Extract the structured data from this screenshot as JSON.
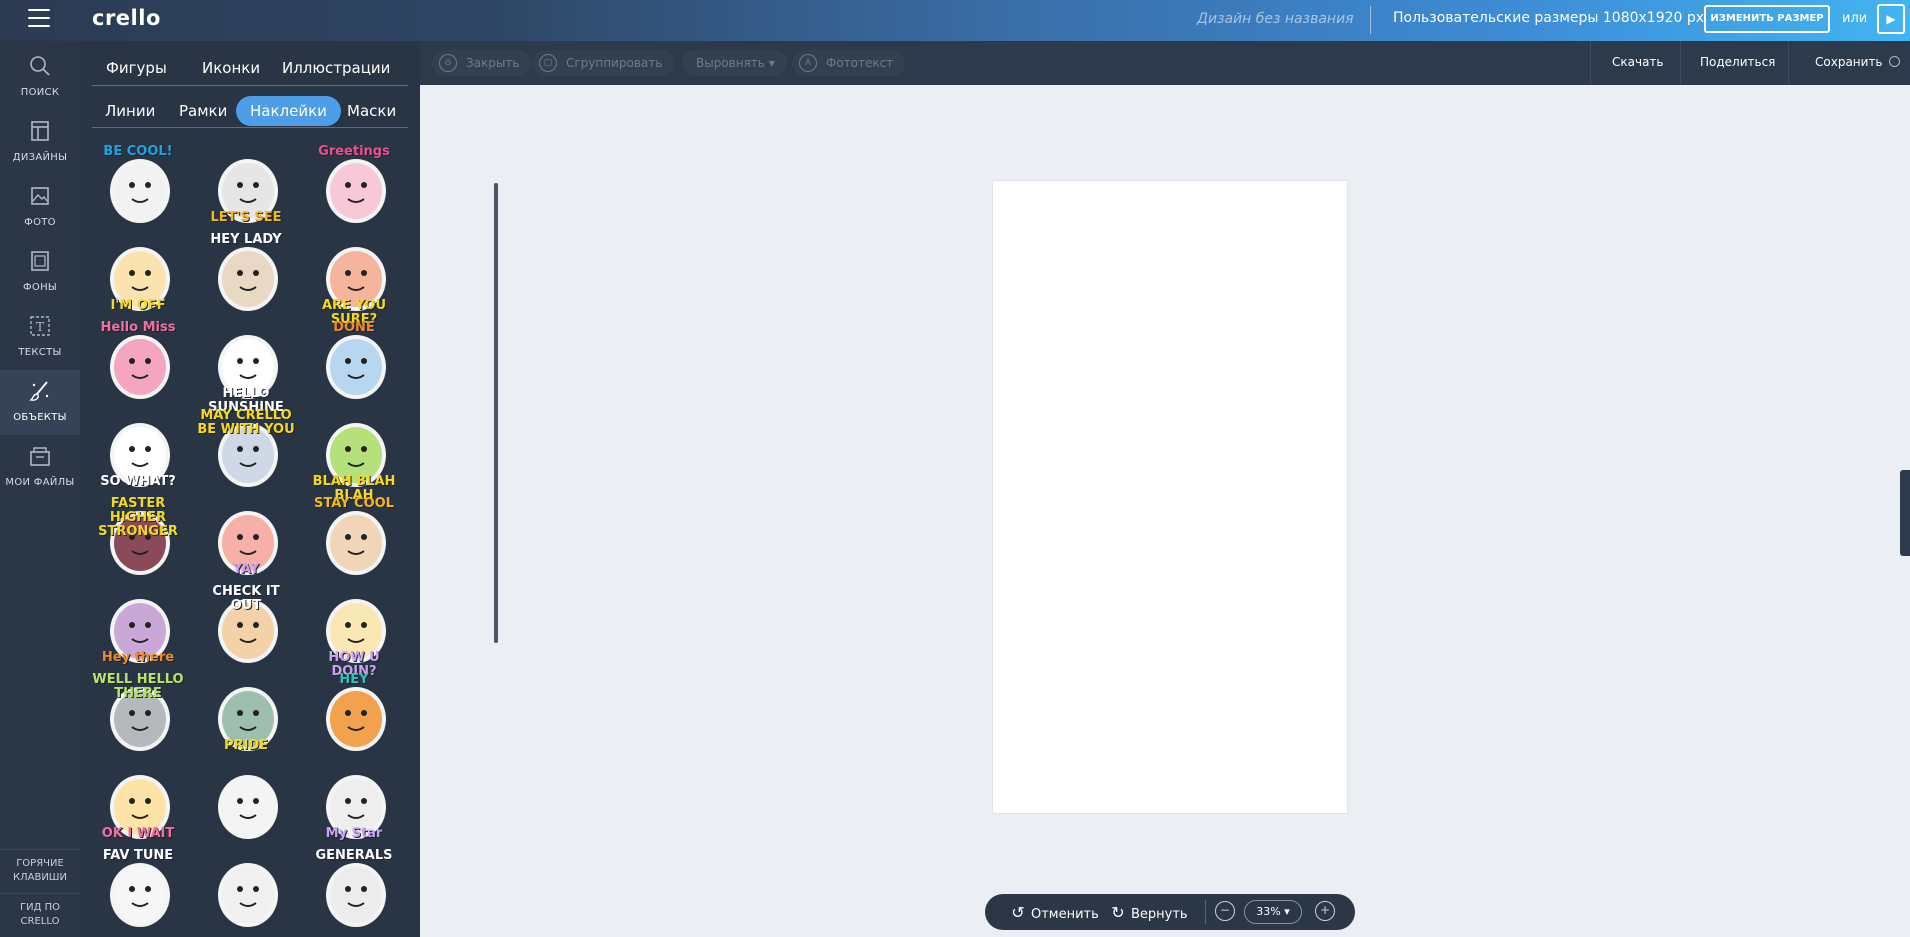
{
  "app": {
    "logo": "crello",
    "menu_icon": "hamburger-icon"
  },
  "topbar": {
    "doc_title": "Дизайн без названия",
    "size_label": "Пользовательские размеры 1080x1920 px",
    "resize_button": "ИЗМЕНИТЬ РАЗМЕР",
    "or_label": "или",
    "present_icon": "▶"
  },
  "rail": {
    "items": [
      {
        "label": "ПОИСК",
        "icon": "search-icon"
      },
      {
        "label": "ДИЗАЙНЫ",
        "icon": "layout-icon"
      },
      {
        "label": "ФОТО",
        "icon": "photo-icon"
      },
      {
        "label": "ФОНЫ",
        "icon": "background-icon"
      },
      {
        "label": "ТЕКСТЫ",
        "icon": "text-icon"
      },
      {
        "label": "ОБЪЕКТЫ",
        "icon": "brush-icon",
        "active": true
      },
      {
        "label": "МОИ ФАЙЛЫ",
        "icon": "folder-icon"
      }
    ],
    "hotkeys": "ГОРЯЧИЕ КЛАВИШИ",
    "guide": "ГИД ПО CRELLO"
  },
  "panel": {
    "tabs_row1": [
      "Фигуры",
      "Иконки",
      "Иллюстрации"
    ],
    "tabs_row2": [
      "Линии",
      "Рамки",
      "Наклейки",
      "Маски"
    ],
    "active_tab": "Наклейки",
    "stickers": [
      {
        "caption": "BE COOL!",
        "color": "#1fa3e0"
      },
      {
        "caption": "LET'S SEE",
        "color": "#f5b81c"
      },
      {
        "caption": "Greetings",
        "color": "#e9508f"
      },
      {
        "caption": "I'M OFF",
        "color": "#f5d91c"
      },
      {
        "caption": "HEY LADY",
        "color": "#ffffff"
      },
      {
        "caption": "ARE YOU SURE?",
        "color": "#f5d91c"
      },
      {
        "caption": "Hello Miss",
        "color": "#f06f9e"
      },
      {
        "caption": "HELLO SUNSHINE",
        "color": "#ffffff"
      },
      {
        "caption": "DONE",
        "color": "#f08a24"
      },
      {
        "caption": "SO WHAT?",
        "color": "#ffffff"
      },
      {
        "caption": "MAY CRELLO BE WITH YOU",
        "color": "#f5d91c"
      },
      {
        "caption": "BLAH BLAH BLAH",
        "color": "#f5d91c"
      },
      {
        "caption": "FASTER HIGHER STRONGER",
        "color": "#f5d91c"
      },
      {
        "caption": "YAY",
        "color": "#c9a3f0"
      },
      {
        "caption": "STAY COOL",
        "color": "#f5b81c"
      },
      {
        "caption": "Hey there",
        "color": "#f08a24"
      },
      {
        "caption": "CHECK IT OUT",
        "color": "#ffffff"
      },
      {
        "caption": "HOW U DOIN?",
        "color": "#c9a3f0"
      },
      {
        "caption": "WELL HELLO THERE",
        "color": "#b7e36a"
      },
      {
        "caption": "PRIDE",
        "color": "#f5d91c"
      },
      {
        "caption": "HEY",
        "color": "#2fc2b0"
      },
      {
        "caption": "OK I WAIT",
        "color": "#f06f9e"
      },
      {
        "caption": "",
        "color": "#ffffff"
      },
      {
        "caption": "My Star",
        "color": "#c9a3f0"
      },
      {
        "caption": "FAV TUNE",
        "color": "#ffffff"
      },
      {
        "caption": "",
        "color": "#ffffff"
      },
      {
        "caption": "GENERALS",
        "color": "#ffffff"
      }
    ]
  },
  "toolbar": {
    "close": "Закрыть",
    "group": "Сгруппировать",
    "align": "Выровнять",
    "phototext": "Фототекст",
    "download": "Скачать",
    "share": "Поделиться",
    "save": "Сохранить"
  },
  "bottom": {
    "undo": "Отменить",
    "redo": "Вернуть",
    "zoom": "33%"
  },
  "colors": {
    "accent": "#4d9ee6",
    "panel": "#293445",
    "rail": "#2b3646",
    "canvas_bg": "#ebeef2"
  }
}
